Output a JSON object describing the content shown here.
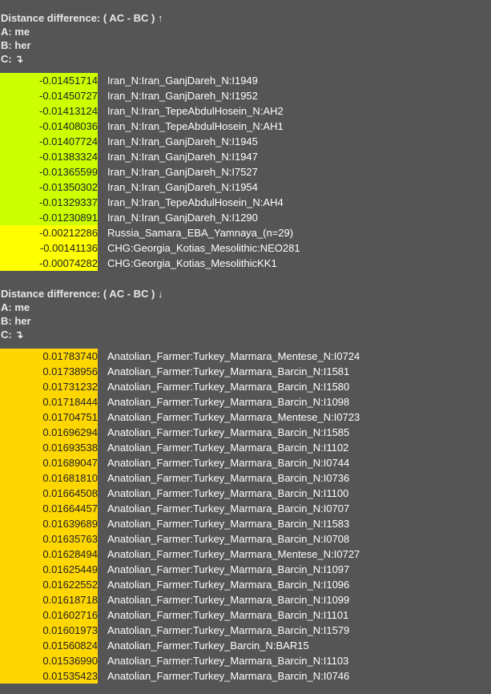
{
  "sections": [
    {
      "title": "Distance difference: ( AC - BC ) ↑",
      "a": "A: me",
      "b": "B: her",
      "c": "C: ↴",
      "rows": [
        {
          "value": "-0.01451714",
          "label": "Iran_N:Iran_GanjDareh_N:I1949",
          "color": "#ccff00"
        },
        {
          "value": "-0.01450727",
          "label": "Iran_N:Iran_GanjDareh_N:I1952",
          "color": "#ccff00"
        },
        {
          "value": "-0.01413124",
          "label": "Iran_N:Iran_TepeAbdulHosein_N:AH2",
          "color": "#ccff00"
        },
        {
          "value": "-0.01408036",
          "label": "Iran_N:Iran_TepeAbdulHosein_N:AH1",
          "color": "#ccff00"
        },
        {
          "value": "-0.01407724",
          "label": "Iran_N:Iran_GanjDareh_N:I1945",
          "color": "#ccff00"
        },
        {
          "value": "-0.01383324",
          "label": "Iran_N:Iran_GanjDareh_N:I1947",
          "color": "#ccff00"
        },
        {
          "value": "-0.01365599",
          "label": "Iran_N:Iran_GanjDareh_N:I7527",
          "color": "#ccff00"
        },
        {
          "value": "-0.01350302",
          "label": "Iran_N:Iran_GanjDareh_N:I1954",
          "color": "#ccff00"
        },
        {
          "value": "-0.01329337",
          "label": "Iran_N:Iran_TepeAbdulHosein_N:AH4",
          "color": "#ccff00"
        },
        {
          "value": "-0.01230891",
          "label": "Iran_N:Iran_GanjDareh_N:I1290",
          "color": "#ccff00"
        },
        {
          "value": "-0.00212286",
          "label": "Russia_Samara_EBA_Yamnaya_(n=29)",
          "color": "#ffff00"
        },
        {
          "value": "-0.00141136",
          "label": "CHG:Georgia_Kotias_Mesolithic:NEO281",
          "color": "#ffff00"
        },
        {
          "value": "-0.00074282",
          "label": "CHG:Georgia_Kotias_MesolithicKK1",
          "color": "#ffff00"
        }
      ]
    },
    {
      "title": "Distance difference: ( AC - BC ) ↓",
      "a": "A: me",
      "b": "B: her",
      "c": "C: ↴",
      "rows": [
        {
          "value": "0.01783740",
          "label": "Anatolian_Farmer:Turkey_Marmara_Mentese_N:I0724",
          "color": "#ffd700"
        },
        {
          "value": "0.01738956",
          "label": "Anatolian_Farmer:Turkey_Marmara_Barcin_N:I1581",
          "color": "#ffd700"
        },
        {
          "value": "0.01731232",
          "label": "Anatolian_Farmer:Turkey_Marmara_Barcin_N:I1580",
          "color": "#ffd700"
        },
        {
          "value": "0.01718444",
          "label": "Anatolian_Farmer:Turkey_Marmara_Barcin_N:I1098",
          "color": "#ffd700"
        },
        {
          "value": "0.01704751",
          "label": "Anatolian_Farmer:Turkey_Marmara_Mentese_N:I0723",
          "color": "#ffd700"
        },
        {
          "value": "0.01696294",
          "label": "Anatolian_Farmer:Turkey_Marmara_Barcin_N:I1585",
          "color": "#ffd700"
        },
        {
          "value": "0.01693538",
          "label": "Anatolian_Farmer:Turkey_Marmara_Barcin_N:I1102",
          "color": "#ffd700"
        },
        {
          "value": "0.01689047",
          "label": "Anatolian_Farmer:Turkey_Marmara_Barcin_N:I0744",
          "color": "#ffd700"
        },
        {
          "value": "0.01681810",
          "label": "Anatolian_Farmer:Turkey_Marmara_Barcin_N:I0736",
          "color": "#ffd700"
        },
        {
          "value": "0.01664508",
          "label": "Anatolian_Farmer:Turkey_Marmara_Barcin_N:I1100",
          "color": "#ffd700"
        },
        {
          "value": "0.01664457",
          "label": "Anatolian_Farmer:Turkey_Marmara_Barcin_N:I0707",
          "color": "#ffd700"
        },
        {
          "value": "0.01639689",
          "label": "Anatolian_Farmer:Turkey_Marmara_Barcin_N:I1583",
          "color": "#ffd700"
        },
        {
          "value": "0.01635763",
          "label": "Anatolian_Farmer:Turkey_Marmara_Barcin_N:I0708",
          "color": "#ffd700"
        },
        {
          "value": "0.01628494",
          "label": "Anatolian_Farmer:Turkey_Marmara_Mentese_N:I0727",
          "color": "#ffd700"
        },
        {
          "value": "0.01625449",
          "label": "Anatolian_Farmer:Turkey_Marmara_Barcin_N:I1097",
          "color": "#ffd700"
        },
        {
          "value": "0.01622552",
          "label": "Anatolian_Farmer:Turkey_Marmara_Barcin_N:I1096",
          "color": "#ffd700"
        },
        {
          "value": "0.01618718",
          "label": "Anatolian_Farmer:Turkey_Marmara_Barcin_N:I1099",
          "color": "#ffd700"
        },
        {
          "value": "0.01602716",
          "label": "Anatolian_Farmer:Turkey_Marmara_Barcin_N:I1101",
          "color": "#ffd700"
        },
        {
          "value": "0.01601973",
          "label": "Anatolian_Farmer:Turkey_Marmara_Barcin_N:I1579",
          "color": "#ffd700"
        },
        {
          "value": "0.01560824",
          "label": "Anatolian_Farmer:Turkey_Barcin_N:BAR15",
          "color": "#ffd700"
        },
        {
          "value": "0.01536990",
          "label": "Anatolian_Farmer:Turkey_Marmara_Barcin_N:I1103",
          "color": "#ffd700"
        },
        {
          "value": "0.01535423",
          "label": "Anatolian_Farmer:Turkey_Marmara_Barcin_N:I0746",
          "color": "#ffd700"
        }
      ]
    }
  ]
}
